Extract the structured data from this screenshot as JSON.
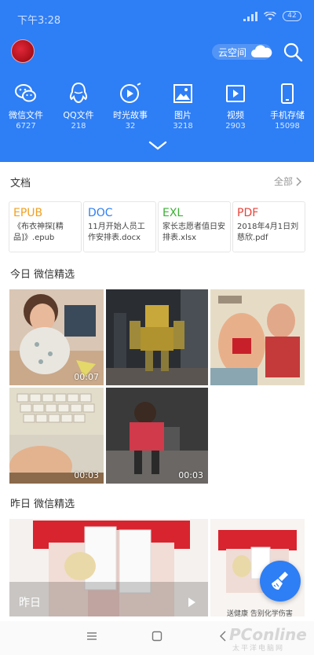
{
  "status": {
    "time": "下午3:28",
    "battery": "42"
  },
  "header": {
    "cloud_label": "云空间"
  },
  "categories": [
    {
      "label": "微信文件",
      "count": "6727"
    },
    {
      "label": "QQ文件",
      "count": "218"
    },
    {
      "label": "时光故事",
      "count": "32"
    },
    {
      "label": "图片",
      "count": "3218"
    },
    {
      "label": "视频",
      "count": "2903"
    },
    {
      "label": "手机存储",
      "count": "15098"
    }
  ],
  "documents": {
    "title": "文档",
    "more": "全部",
    "items": [
      {
        "type": "EPUB",
        "name": "《布衣神探[精品]》.epub",
        "color": "#f0a020"
      },
      {
        "type": "DOC",
        "name": "11月开始人员工作安排表.docx",
        "color": "#2e7ef5"
      },
      {
        "type": "EXL",
        "name": "家长志愿者值日安排表.xlsx",
        "color": "#3cb034"
      },
      {
        "type": "PDF",
        "name": "2018年4月1日刘慈欣.pdf",
        "color": "#e8433b"
      }
    ]
  },
  "today": {
    "title": "今日 微信精选",
    "durations": [
      "00:07",
      "00:03",
      "00:03"
    ]
  },
  "yesterday": {
    "title": "昨日 微信精选",
    "label": "昨日",
    "promo": "送健康 告别化学伤害"
  },
  "watermark": {
    "brand": "PConline",
    "sub": "太平洋电脑网"
  },
  "colors": {
    "accent": "#2e7ef5"
  }
}
